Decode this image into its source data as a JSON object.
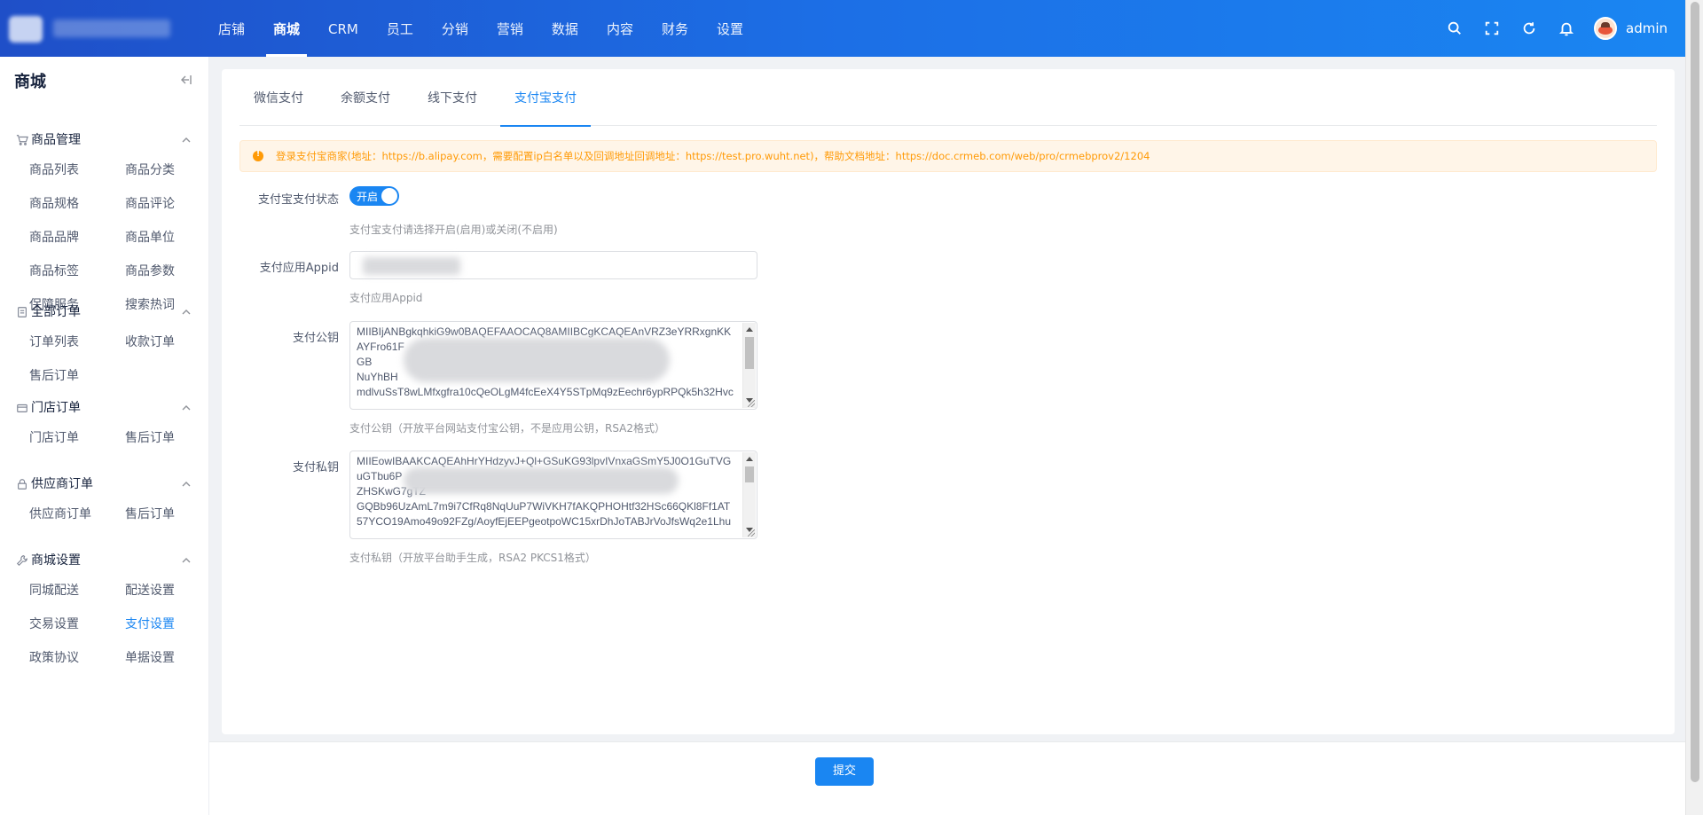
{
  "topnav": {
    "items": [
      "店铺",
      "商城",
      "CRM",
      "员工",
      "分销",
      "营销",
      "数据",
      "内容",
      "财务",
      "设置"
    ],
    "active_index": 1
  },
  "header": {
    "username": "admin",
    "icons": [
      "search-icon",
      "fullscreen-icon",
      "refresh-icon",
      "bell-icon"
    ]
  },
  "sidebar": {
    "title": "商城",
    "groups": [
      {
        "label": "商品管理",
        "icon": "cart-icon",
        "items": [
          "商品列表",
          "商品分类",
          "商品规格",
          "商品评论",
          "商品品牌",
          "商品单位",
          "商品标签",
          "商品参数",
          "保障服务",
          "搜索热词"
        ]
      },
      {
        "label": "全部订单",
        "icon": "document-icon",
        "items": [
          "订单列表",
          "收款订单",
          "售后订单"
        ]
      },
      {
        "label": "门店订单",
        "icon": "store-icon",
        "items": [
          "门店订单",
          "售后订单"
        ]
      },
      {
        "label": "供应商订单",
        "icon": "lock-icon",
        "items": [
          "供应商订单",
          "售后订单"
        ]
      },
      {
        "label": "商城设置",
        "icon": "wrench-icon",
        "items": [
          "同城配送",
          "配送设置",
          "交易设置",
          "支付设置",
          "政策协议",
          "单据设置"
        ]
      }
    ],
    "active_item": "支付设置"
  },
  "tabs": {
    "items": [
      "微信支付",
      "余额支付",
      "线下支付",
      "支付宝支付"
    ],
    "active_index": 3
  },
  "alert": {
    "text": "登录支付宝商家(地址：https://b.alipay.com，需要配置ip白名单以及回调地址回调地址：https://test.pro.wuht.net)，帮助文档地址：https://doc.crmeb.com/web/pro/crmebprov2/1204"
  },
  "form": {
    "status": {
      "label": "支付宝支付状态",
      "switch_text": "开启",
      "on": true,
      "hint": "支付宝支付请选择开启(启用)或关闭(不启用)"
    },
    "appid": {
      "label": "支付应用Appid",
      "value": "",
      "hint": "支付应用Appid"
    },
    "public_key": {
      "label": "支付公钥",
      "lines": [
        "MIIBIjANBgkqhkiG9w0BAQEFAAOCAQ8AMIIBCgKCAQEAnVRZ3eYRRxgnKK",
        "AYFro61F",
        "GB",
        "NuYhBH",
        "mdlvuSsT8wLMfxgfra10cQeOLgM4fcEeX4Y5STpMq9zEechr6ypRPQk5h32Hvc"
      ],
      "hint": "支付公钥（开放平台网站支付宝公钥，不是应用公钥，RSA2格式）"
    },
    "private_key": {
      "label": "支付私钥",
      "lines": [
        "MIIEowIBAAKCAQEAhHrYHdzyvJ+Ql+GSuKG93lpvIVnxaGSmY5J0O1GuTVG",
        "uGTbu6P",
        "ZHSKwG7gTZ",
        "GQBb96UzAmL7m9i7CfRq8NqUuP7WiVKH7fAKQPHOHtf32HSc66QKl8Ff1AT",
        "57YCO19Amo49o92FZg/AoyfEjEEPgeotpoWC15xrDhJoTABJrVoJfsWq2e1Lhu"
      ],
      "hint": "支付私钥（开放平台助手生成，RSA2 PKCS1格式）"
    }
  },
  "footer": {
    "submit_label": "提交"
  },
  "colors": {
    "primary": "#1a86f2",
    "warning": "#ff9a06",
    "header_start": "#1f4fc8",
    "header_end": "#1a86f2"
  }
}
